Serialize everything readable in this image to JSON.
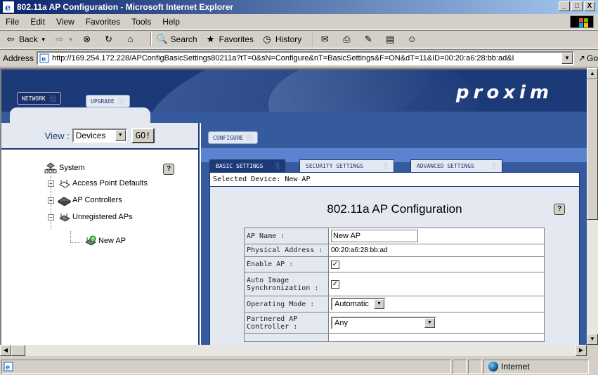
{
  "window": {
    "title": "802.11a AP Configuration - Microsoft Internet Explorer",
    "buttons": [
      "_",
      "□",
      "X"
    ]
  },
  "menu": [
    "File",
    "Edit",
    "View",
    "Favorites",
    "Tools",
    "Help"
  ],
  "toolbar": {
    "back": "Back",
    "search": "Search",
    "favorites": "Favorites",
    "history": "History"
  },
  "address": {
    "label": "Address",
    "url": "http://169.254.172.228/APConfigBasicSettings80211a?tT=0&sN=Configure&nT=BasicSettings&F=ON&dT=11&ID=00:20:a6:28:bb:ad&I",
    "go": "Go"
  },
  "banner": {
    "logo": "proxim",
    "nav_network": "NETWORK",
    "nav_upgrade": "UPGRADE"
  },
  "left": {
    "view_label": "View :",
    "view_selected": "Devices",
    "go_button": "GO!",
    "tree": {
      "root": "System",
      "items": [
        "Access Point Defaults",
        "AP Controllers",
        "Unregistered APs"
      ],
      "child": "New AP"
    }
  },
  "right": {
    "configure_tab": "CONFIGURE",
    "subtabs": [
      "BASIC SETTINGS",
      "SECURITY SETTINGS",
      "ADVANCED SETTINGS"
    ],
    "selected_device": "Selected Device: New AP",
    "title": "802.11a AP Configuration",
    "fields": {
      "ap_name_label": "AP Name :",
      "ap_name_value": "New AP",
      "physical_label": "Physical Address :",
      "physical_value": "00:20:a6:28:bb:ad",
      "enable_label": "Enable AP :",
      "auto_label": "Auto Image Synchronization :",
      "mode_label": "Operating Mode :",
      "mode_value": "Automatic",
      "partner_label": "Partnered AP Controller :",
      "partner_value": "Any"
    }
  },
  "status": {
    "zone": "Internet"
  },
  "help_glyph": "?",
  "checked_glyph": "✓"
}
